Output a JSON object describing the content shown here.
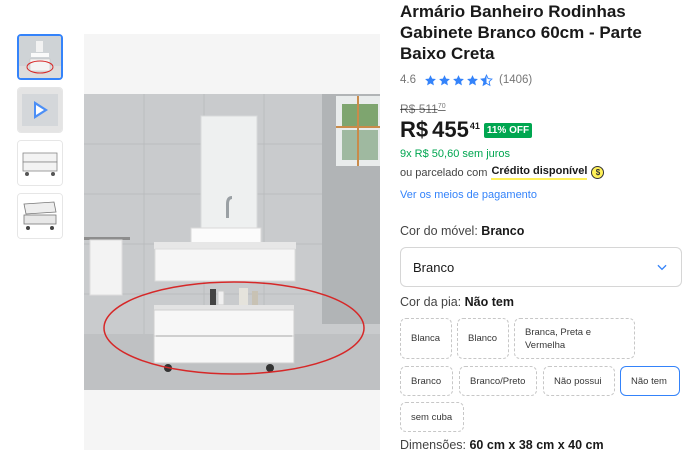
{
  "product": {
    "title": "Armário Banheiro Rodinhas Gabinete Branco 60cm - Parte Baixo Creta",
    "rating_score": "4.6",
    "rating_value": 4.5,
    "review_count": "(1406)"
  },
  "pricing": {
    "old_currency": "R$",
    "old_amount": "511",
    "old_cents": "70",
    "currency": "R$",
    "amount": "455",
    "cents": "41",
    "discount": "11% OFF",
    "installments": "9x R$ 50,60 sem juros",
    "credit_prefix": "ou parcelado com",
    "credit_label": "Crédito disponível",
    "payment_link": "Ver os meios de pagamento"
  },
  "variations": {
    "furniture_color_label": "Cor do móvel:",
    "furniture_color_value": "Branco",
    "furniture_select_value": "Branco",
    "sink_color_label": "Cor da pia:",
    "sink_color_value": "Não tem",
    "sink_options": [
      "Blanca",
      "Blanco",
      "Branca, Preta e Vermelha",
      "Branco",
      "Branco/Preto",
      "Não possui",
      "Não tem",
      "sem cuba"
    ],
    "selected_sink_option": "Não tem"
  },
  "dimensions": {
    "label": "Dimensões:",
    "value": "60 cm x 38 cm x 40 cm"
  },
  "colors": {
    "accent_blue": "#3483fa",
    "discount_green": "#00a650",
    "credit_yellow": "#fff159",
    "annotation_red": "#d62828"
  },
  "icons": {
    "star": "star-icon",
    "dropdown": "chevron-down-icon",
    "coin": "coin-icon",
    "video": "play-icon"
  }
}
